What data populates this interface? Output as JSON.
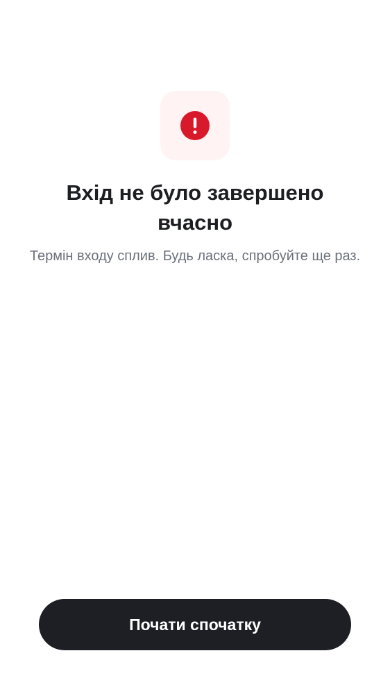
{
  "error_screen": {
    "icon": "error-exclamation-icon",
    "title": "Вхід не було завершено вчасно",
    "message": "Термін входу сплив. Будь ласка, спробуйте ще раз.",
    "restart_button_label": "Почати спочатку"
  },
  "colors": {
    "icon_circle": "#d8192b",
    "icon_tile_background": "#fff4f3",
    "title_text": "#1d1e22",
    "message_text": "#6b717b",
    "button_background": "#1e1f24",
    "button_text": "#ffffff"
  }
}
